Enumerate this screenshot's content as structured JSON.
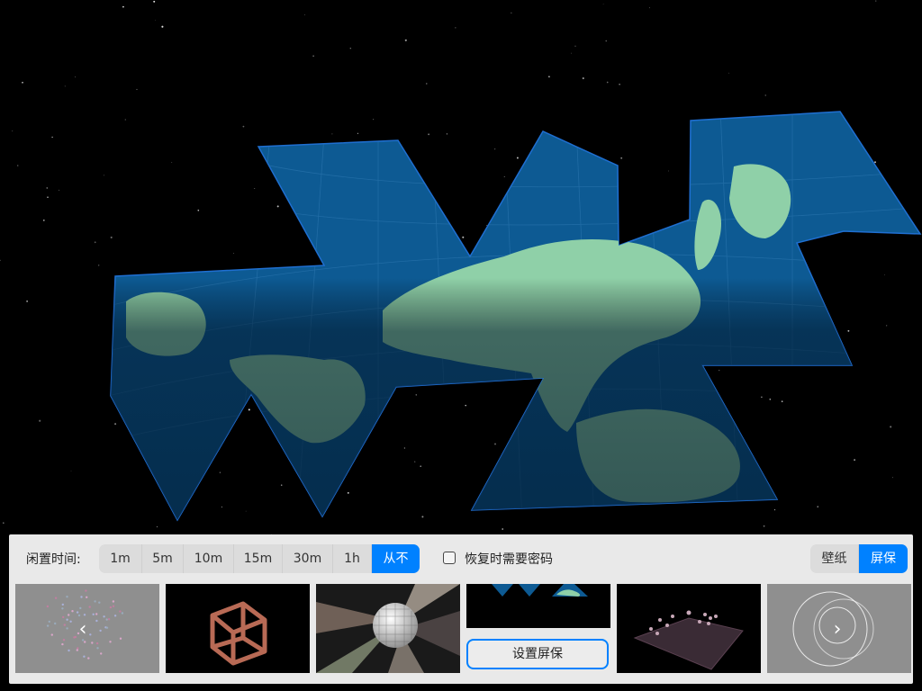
{
  "idle": {
    "label": "闲置时间:",
    "options": [
      "1m",
      "5m",
      "10m",
      "15m",
      "30m",
      "1h",
      "从不"
    ],
    "selected": "从不"
  },
  "password": {
    "label": "恢复时需要密码",
    "checked": false
  },
  "mode": {
    "options": [
      "壁纸",
      "屏保"
    ],
    "selected": "屏保"
  },
  "screensavers": {
    "set_button_label": "设置屏保",
    "items": [
      {
        "name": "particles",
        "icon": "particle-cloud"
      },
      {
        "name": "wire-cube",
        "icon": "wire-cube"
      },
      {
        "name": "disco-ball",
        "icon": "disco-ball"
      },
      {
        "name": "dymaxion-map",
        "icon": "world-map",
        "selected": true
      },
      {
        "name": "pieces-grid",
        "icon": "chess-pieces"
      },
      {
        "name": "rings",
        "icon": "rings"
      }
    ]
  },
  "nav": {
    "prev_icon": "chevron-left-icon",
    "next_icon": "chevron-right-icon"
  },
  "colors": {
    "accent": "#0081ff",
    "panel": "#e9e9e9",
    "ocean": "#0d5a93",
    "land": "#8fd0a8"
  }
}
